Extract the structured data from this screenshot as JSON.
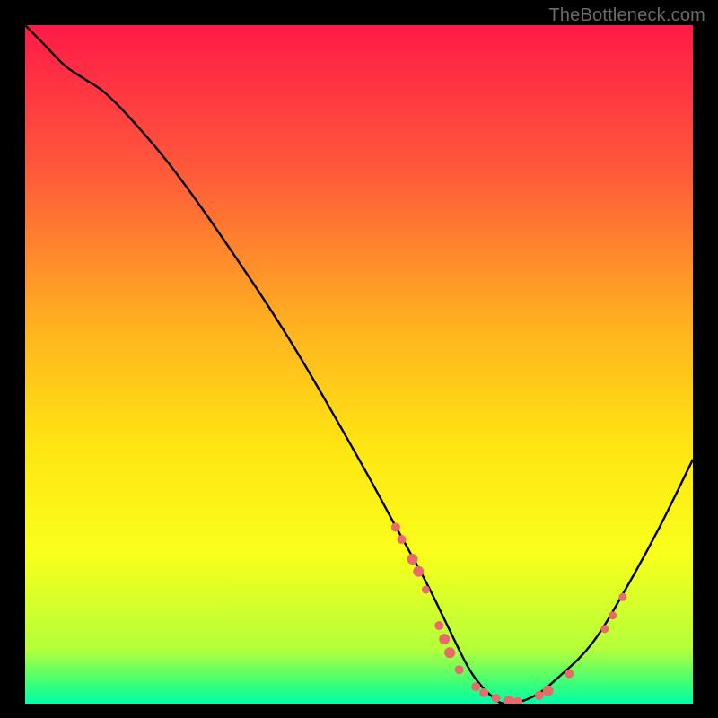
{
  "watermark": "TheBottleneck.com",
  "chart_data": {
    "type": "line",
    "title": "",
    "xlabel": "",
    "ylabel": "",
    "xlim": [
      0,
      100
    ],
    "ylim": [
      0,
      100
    ],
    "grid": false,
    "legend": false,
    "background_gradient_stops": [
      {
        "offset": 0.0,
        "color": "#ff1a48"
      },
      {
        "offset": 0.22,
        "color": "#ff5b3a"
      },
      {
        "offset": 0.45,
        "color": "#ffb41f"
      },
      {
        "offset": 0.62,
        "color": "#ffe512"
      },
      {
        "offset": 0.78,
        "color": "#f9ff1a"
      },
      {
        "offset": 0.92,
        "color": "#b4ff3a"
      },
      {
        "offset": 0.97,
        "color": "#3cff78"
      },
      {
        "offset": 1.0,
        "color": "#00ffaa"
      }
    ],
    "series": [
      {
        "name": "bottleneck-curve",
        "color": "#000000",
        "x": [
          0,
          3,
          6,
          9,
          12,
          16,
          22,
          30,
          40,
          50,
          55,
          60,
          63,
          66,
          68,
          70,
          72,
          76,
          80,
          85,
          90,
          95,
          100
        ],
        "y": [
          100,
          97,
          94,
          92,
          90,
          86,
          79,
          68,
          53,
          36,
          27,
          18,
          12,
          6,
          3,
          1,
          0,
          1,
          4,
          9,
          17,
          26,
          36
        ]
      }
    ],
    "markers": {
      "name": "sample-points",
      "color": "#e86a6a",
      "radius_default": 4.5,
      "points": [
        {
          "x": 55.5,
          "y": 26.0,
          "r": 5
        },
        {
          "x": 56.4,
          "y": 24.2,
          "r": 5
        },
        {
          "x": 58.0,
          "y": 21.3,
          "r": 6
        },
        {
          "x": 58.9,
          "y": 19.5,
          "r": 6
        },
        {
          "x": 60.0,
          "y": 16.8,
          "r": 4.5
        },
        {
          "x": 62.0,
          "y": 11.5,
          "r": 5
        },
        {
          "x": 62.8,
          "y": 9.5,
          "r": 6
        },
        {
          "x": 63.6,
          "y": 7.5,
          "r": 6
        },
        {
          "x": 65.0,
          "y": 5.0,
          "r": 5
        },
        {
          "x": 67.5,
          "y": 2.5,
          "r": 5
        },
        {
          "x": 68.7,
          "y": 1.6,
          "r": 5
        },
        {
          "x": 70.5,
          "y": 0.8,
          "r": 5
        },
        {
          "x": 72.5,
          "y": 0.4,
          "r": 6
        },
        {
          "x": 73.8,
          "y": 0.3,
          "r": 5
        },
        {
          "x": 77.0,
          "y": 1.2,
          "r": 5
        },
        {
          "x": 78.3,
          "y": 1.9,
          "r": 6
        },
        {
          "x": 81.5,
          "y": 4.4,
          "r": 5
        },
        {
          "x": 86.8,
          "y": 11.0,
          "r": 4.5
        },
        {
          "x": 88.0,
          "y": 13.0,
          "r": 4.5
        },
        {
          "x": 89.5,
          "y": 15.7,
          "r": 4.5
        }
      ]
    }
  }
}
